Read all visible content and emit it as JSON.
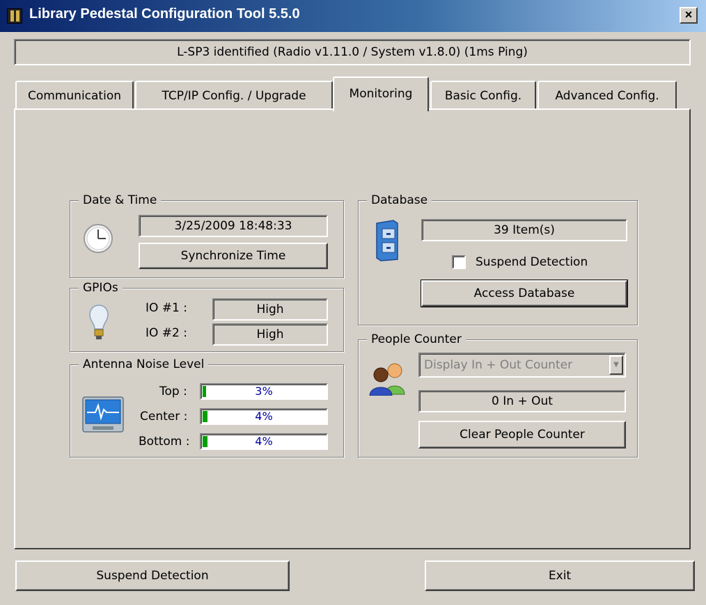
{
  "window": {
    "title": "Library Pedestal Configuration Tool 5.5.0",
    "close_label": "×"
  },
  "status": "L-SP3 identified (Radio v1.11.0 / System v1.8.0) (1ms Ping)",
  "tabs": [
    {
      "label": "Communication"
    },
    {
      "label": "TCP/IP Config. / Upgrade"
    },
    {
      "label": "Monitoring"
    },
    {
      "label": "Basic Config."
    },
    {
      "label": "Advanced Config."
    }
  ],
  "active_tab": "Monitoring",
  "datetime": {
    "legend": "Date & Time",
    "value": "3/25/2009 18:48:33",
    "sync_label": "Synchronize Time",
    "icon": "clock-icon"
  },
  "gpios": {
    "legend": "GPIOs",
    "icon": "lightbulb-icon",
    "items": [
      {
        "label": "IO #1 :",
        "value": "High"
      },
      {
        "label": "IO #2 :",
        "value": "High"
      }
    ]
  },
  "antenna": {
    "legend": "Antenna Noise Level",
    "icon": "monitor-icon",
    "levels": [
      {
        "label": "Top :",
        "text": "3%",
        "percent": 3
      },
      {
        "label": "Center :",
        "text": "4%",
        "percent": 4
      },
      {
        "label": "Bottom :",
        "text": "4%",
        "percent": 4
      }
    ],
    "fill_color": "#00a000"
  },
  "database": {
    "legend": "Database",
    "icon": "file-cabinet-icon",
    "count": "39 Item(s)",
    "suspend_label": "Suspend Detection",
    "suspend_checked": false,
    "access_label": "Access Database"
  },
  "people_counter": {
    "legend": "People Counter",
    "icon": "people-icon",
    "select_value": "Display In + Out Counter",
    "count": "0 In + Out",
    "clear_label": "Clear People Counter"
  },
  "footer": {
    "suspend_label": "Suspend Detection",
    "exit_label": "Exit"
  }
}
